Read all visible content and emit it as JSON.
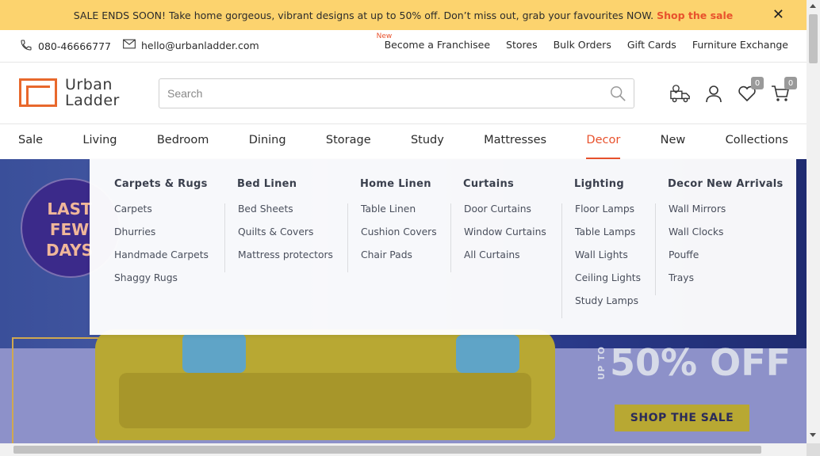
{
  "promo": {
    "text": "SALE ENDS SOON! Take home gorgeous, vibrant designs at up to 50% off. Don’t miss out, grab your favourites NOW.",
    "link": "Shop the sale",
    "close": "✕"
  },
  "contact": {
    "phone": "080-46666777",
    "email": "hello@urbanladder.com"
  },
  "toplinks": {
    "new_tag": "New",
    "items": [
      "Become a Franchisee",
      "Stores",
      "Bulk Orders",
      "Gift Cards",
      "Furniture Exchange"
    ]
  },
  "header": {
    "logo_line1": "Urban",
    "logo_line2": "Ladder",
    "search_placeholder": "Search",
    "wishlist_count": "0",
    "cart_count": "0"
  },
  "nav": {
    "items": [
      "Sale",
      "Living",
      "Bedroom",
      "Dining",
      "Storage",
      "Study",
      "Mattresses",
      "Decor",
      "New",
      "Collections"
    ],
    "active": "Decor"
  },
  "mega": {
    "columns": [
      {
        "title": "Carpets & Rugs",
        "links": [
          "Carpets",
          "Dhurries",
          "Handmade Carpets",
          "Shaggy Rugs"
        ]
      },
      {
        "title": "Bed Linen",
        "links": [
          "Bed Sheets",
          "Quilts & Covers",
          "Mattress protectors"
        ]
      },
      {
        "title": "Home Linen",
        "links": [
          "Table Linen",
          "Cushion Covers",
          "Chair Pads"
        ]
      },
      {
        "title": "Curtains",
        "links": [
          "Door Curtains",
          "Window Curtains",
          "All Curtains"
        ]
      },
      {
        "title": "Lighting",
        "links": [
          "Floor Lamps",
          "Table Lamps",
          "Wall Lights",
          "Ceiling Lights",
          "Study Lamps"
        ]
      },
      {
        "title": "Decor New Arrivals",
        "links": [
          "Wall Mirrors",
          "Wall Clocks",
          "Pouffe",
          "Trays"
        ]
      }
    ]
  },
  "hero": {
    "badge_line1": "LAST",
    "badge_line2": "FEW",
    "badge_line3": "DAYS",
    "upto": "UP TO",
    "discount": "50% OFF",
    "cta": "SHOP THE SALE"
  },
  "colors": {
    "promo_bg": "#fcd36e",
    "accent": "#e8512c",
    "logo_orange": "#e8682c"
  }
}
